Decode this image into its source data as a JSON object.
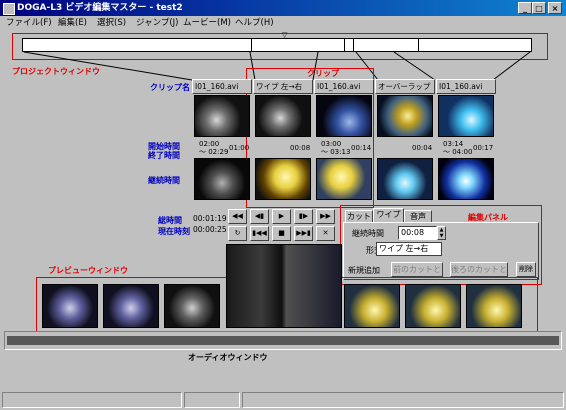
{
  "window": {
    "title": "DOGA-L3 ビデオ編集マスター - test2",
    "minimize": "_",
    "maximize": "□",
    "close": "×"
  },
  "menu": [
    "ファイル(F)",
    "編集(E)",
    "選択(S)",
    "ジャンプ(J)",
    "ムービー(M)",
    "ヘルプ(H)"
  ],
  "project": {
    "label": "プロジェクトウィンドウ",
    "marker": "▽"
  },
  "annotations": {
    "clip": "クリップ",
    "clip_name": "クリップ名",
    "start_time": "開始時間",
    "end_time": "終了時間",
    "duration": "継続時間",
    "total_time": "総時間",
    "current_time": "現在時刻",
    "preview": "プレビューウィンドウ",
    "edit_panel": "編集パネル",
    "audio": "オーディオウィンドウ"
  },
  "clips": [
    {
      "name": "I01_160.avi",
      "start": "02:00",
      "end": "～ 02:29",
      "duration": "01:00"
    },
    {
      "name": "ワイプ 左→右",
      "duration": "00:08"
    },
    {
      "name": "I01_160.avi",
      "start": "03:00",
      "end": "～ 03:13",
      "duration": "00:14"
    },
    {
      "name": "オーバーラップ",
      "duration": "00:04"
    },
    {
      "name": "I01_160.avi",
      "start": "03:14",
      "end": "～ 04:00",
      "duration": "00:17"
    }
  ],
  "timecodes": {
    "total": "00:01:19",
    "current": "00:00:25"
  },
  "transport": {
    "row1": [
      "◀◀",
      "◀▮",
      "▶",
      "▮▶",
      "▶▶"
    ],
    "row2": [
      "↻",
      "▮◀◀",
      "■",
      "▶▶▮",
      "✕"
    ]
  },
  "edit_panel": {
    "tabs": [
      "カット",
      "ワイプ",
      "音声"
    ],
    "duration_label": "継続時間",
    "duration_value": "00:08",
    "type_label": "形式",
    "type_value": "ワイプ 左→右",
    "new_add_label": "新規追加",
    "btn_prev_cut": "前のカットと",
    "btn_next_cut": "後ろのカットと",
    "btn_delete": "削除"
  },
  "colors": {
    "annotation": "#e00000",
    "label_blue": "#0000c0",
    "titlebar": "#000080",
    "face": "#c0c0c0"
  }
}
